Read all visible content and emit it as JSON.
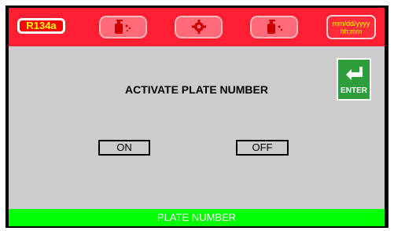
{
  "header": {
    "refrigerant_label": "R134a",
    "icons": [
      "tank-refill-icon",
      "settings-gear-icon",
      "tank-icon"
    ],
    "datetime_line1": "mm/dd/yyyy",
    "datetime_line2": "hh:mm"
  },
  "main": {
    "title": "ACTIVATE PLATE NUMBER",
    "on_label": "ON",
    "off_label": "OFF",
    "enter_label": "ENTER"
  },
  "footer": {
    "label": "PLATE NUMBER"
  },
  "colors": {
    "header_bg": "#ff1f32",
    "screen_bg": "#cccccc",
    "footer_bg": "#00ff00",
    "enter_bg": "#2e9e3c",
    "label_yellow": "#ffff00"
  }
}
